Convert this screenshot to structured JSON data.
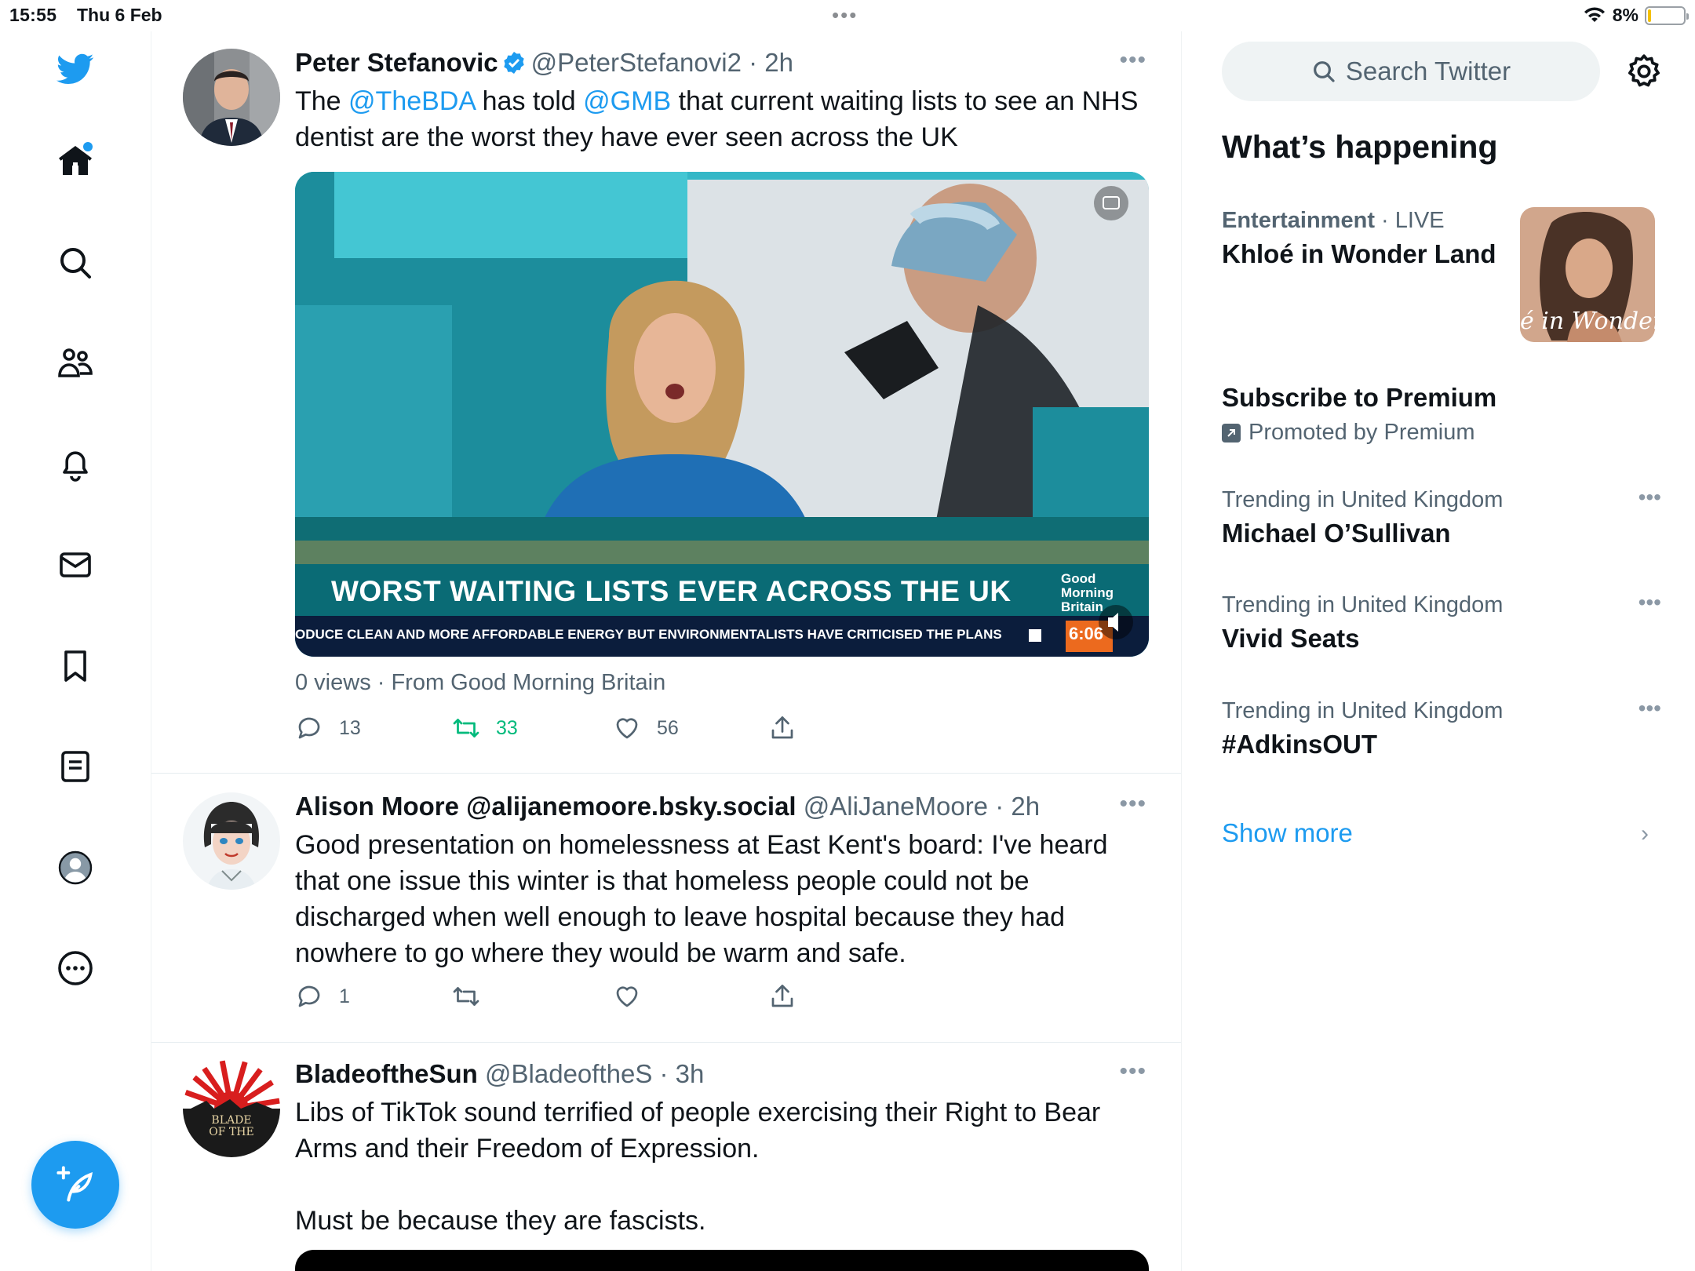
{
  "status_bar": {
    "time": "15:55",
    "date": "Thu 6 Feb",
    "battery": "8%",
    "battery_level": 0.08
  },
  "nav": {
    "items": [
      "home-icon",
      "search-icon",
      "communities-icon",
      "notifications-icon",
      "messages-icon",
      "bookmarks-icon",
      "lists-icon",
      "profile-icon",
      "more-icon"
    ],
    "compose": "compose-icon"
  },
  "tweets": [
    {
      "display_name": "Peter Stefanovic",
      "verified": true,
      "handle": "@PeterStefanovi2",
      "time": "2h",
      "text_parts": [
        "The ",
        "@TheBDA",
        " has told ",
        "@GMB",
        " that current waiting lists to see an NHS dentist are the worst they have ever seen across the UK"
      ],
      "media": {
        "headline": "WORST WAITING LISTS EVER ACROSS THE UK",
        "ticker": "ODUCE CLEAN AND MORE AFFORDABLE ENERGY BUT ENVIRONMENTALISTS HAVE CRITICISED THE PLANS",
        "logo_lines": [
          "Good",
          "Morning",
          "Britain"
        ],
        "clock": "6:06"
      },
      "views": "0 views · From Good Morning Britain",
      "replies": "13",
      "retweets": "33",
      "likes": "56"
    },
    {
      "display_name": "Alison Moore @alijanemoore.bsky.social",
      "handle": "@AliJaneMoore",
      "time": "2h",
      "text": "Good presentation on homelessness at East Kent's board: I've heard that one issue this winter is that homeless people could not be discharged when well enough to leave hospital because they had nowhere to go where they would be warm and safe.",
      "replies": "1"
    },
    {
      "display_name": "BladeoftheSun",
      "handle": "@BladeoftheS",
      "time": "3h",
      "text_line1": "Libs of TikTok sound terrified of people exercising their Right to Bear Arms and their Freedom of Expression.",
      "text_line2": "Must be because they are fascists.",
      "avatar_text": [
        "BLADE",
        "OF THE"
      ]
    }
  ],
  "right": {
    "search_placeholder": "Search Twitter",
    "section_title": "What’s happening",
    "trends": [
      {
        "category": "Entertainment",
        "sep": " · ",
        "status": "LIVE",
        "title": "Khloé in Wonder Land",
        "thumb_text": "é in Wonder L"
      },
      {
        "title": "Subscribe to Premium",
        "promoted": "Promoted by Premium"
      },
      {
        "category": "Trending in United Kingdom",
        "title": "Michael O’Sullivan"
      },
      {
        "category": "Trending in United Kingdom",
        "title": "Vivid Seats"
      },
      {
        "category": "Trending in United Kingdom",
        "title": "#AdkinsOUT"
      }
    ],
    "show_more": "Show more"
  },
  "colors": {
    "accent": "#1d9bf0",
    "retweet_green": "#00ba7c",
    "secondary_text": "#536471"
  }
}
